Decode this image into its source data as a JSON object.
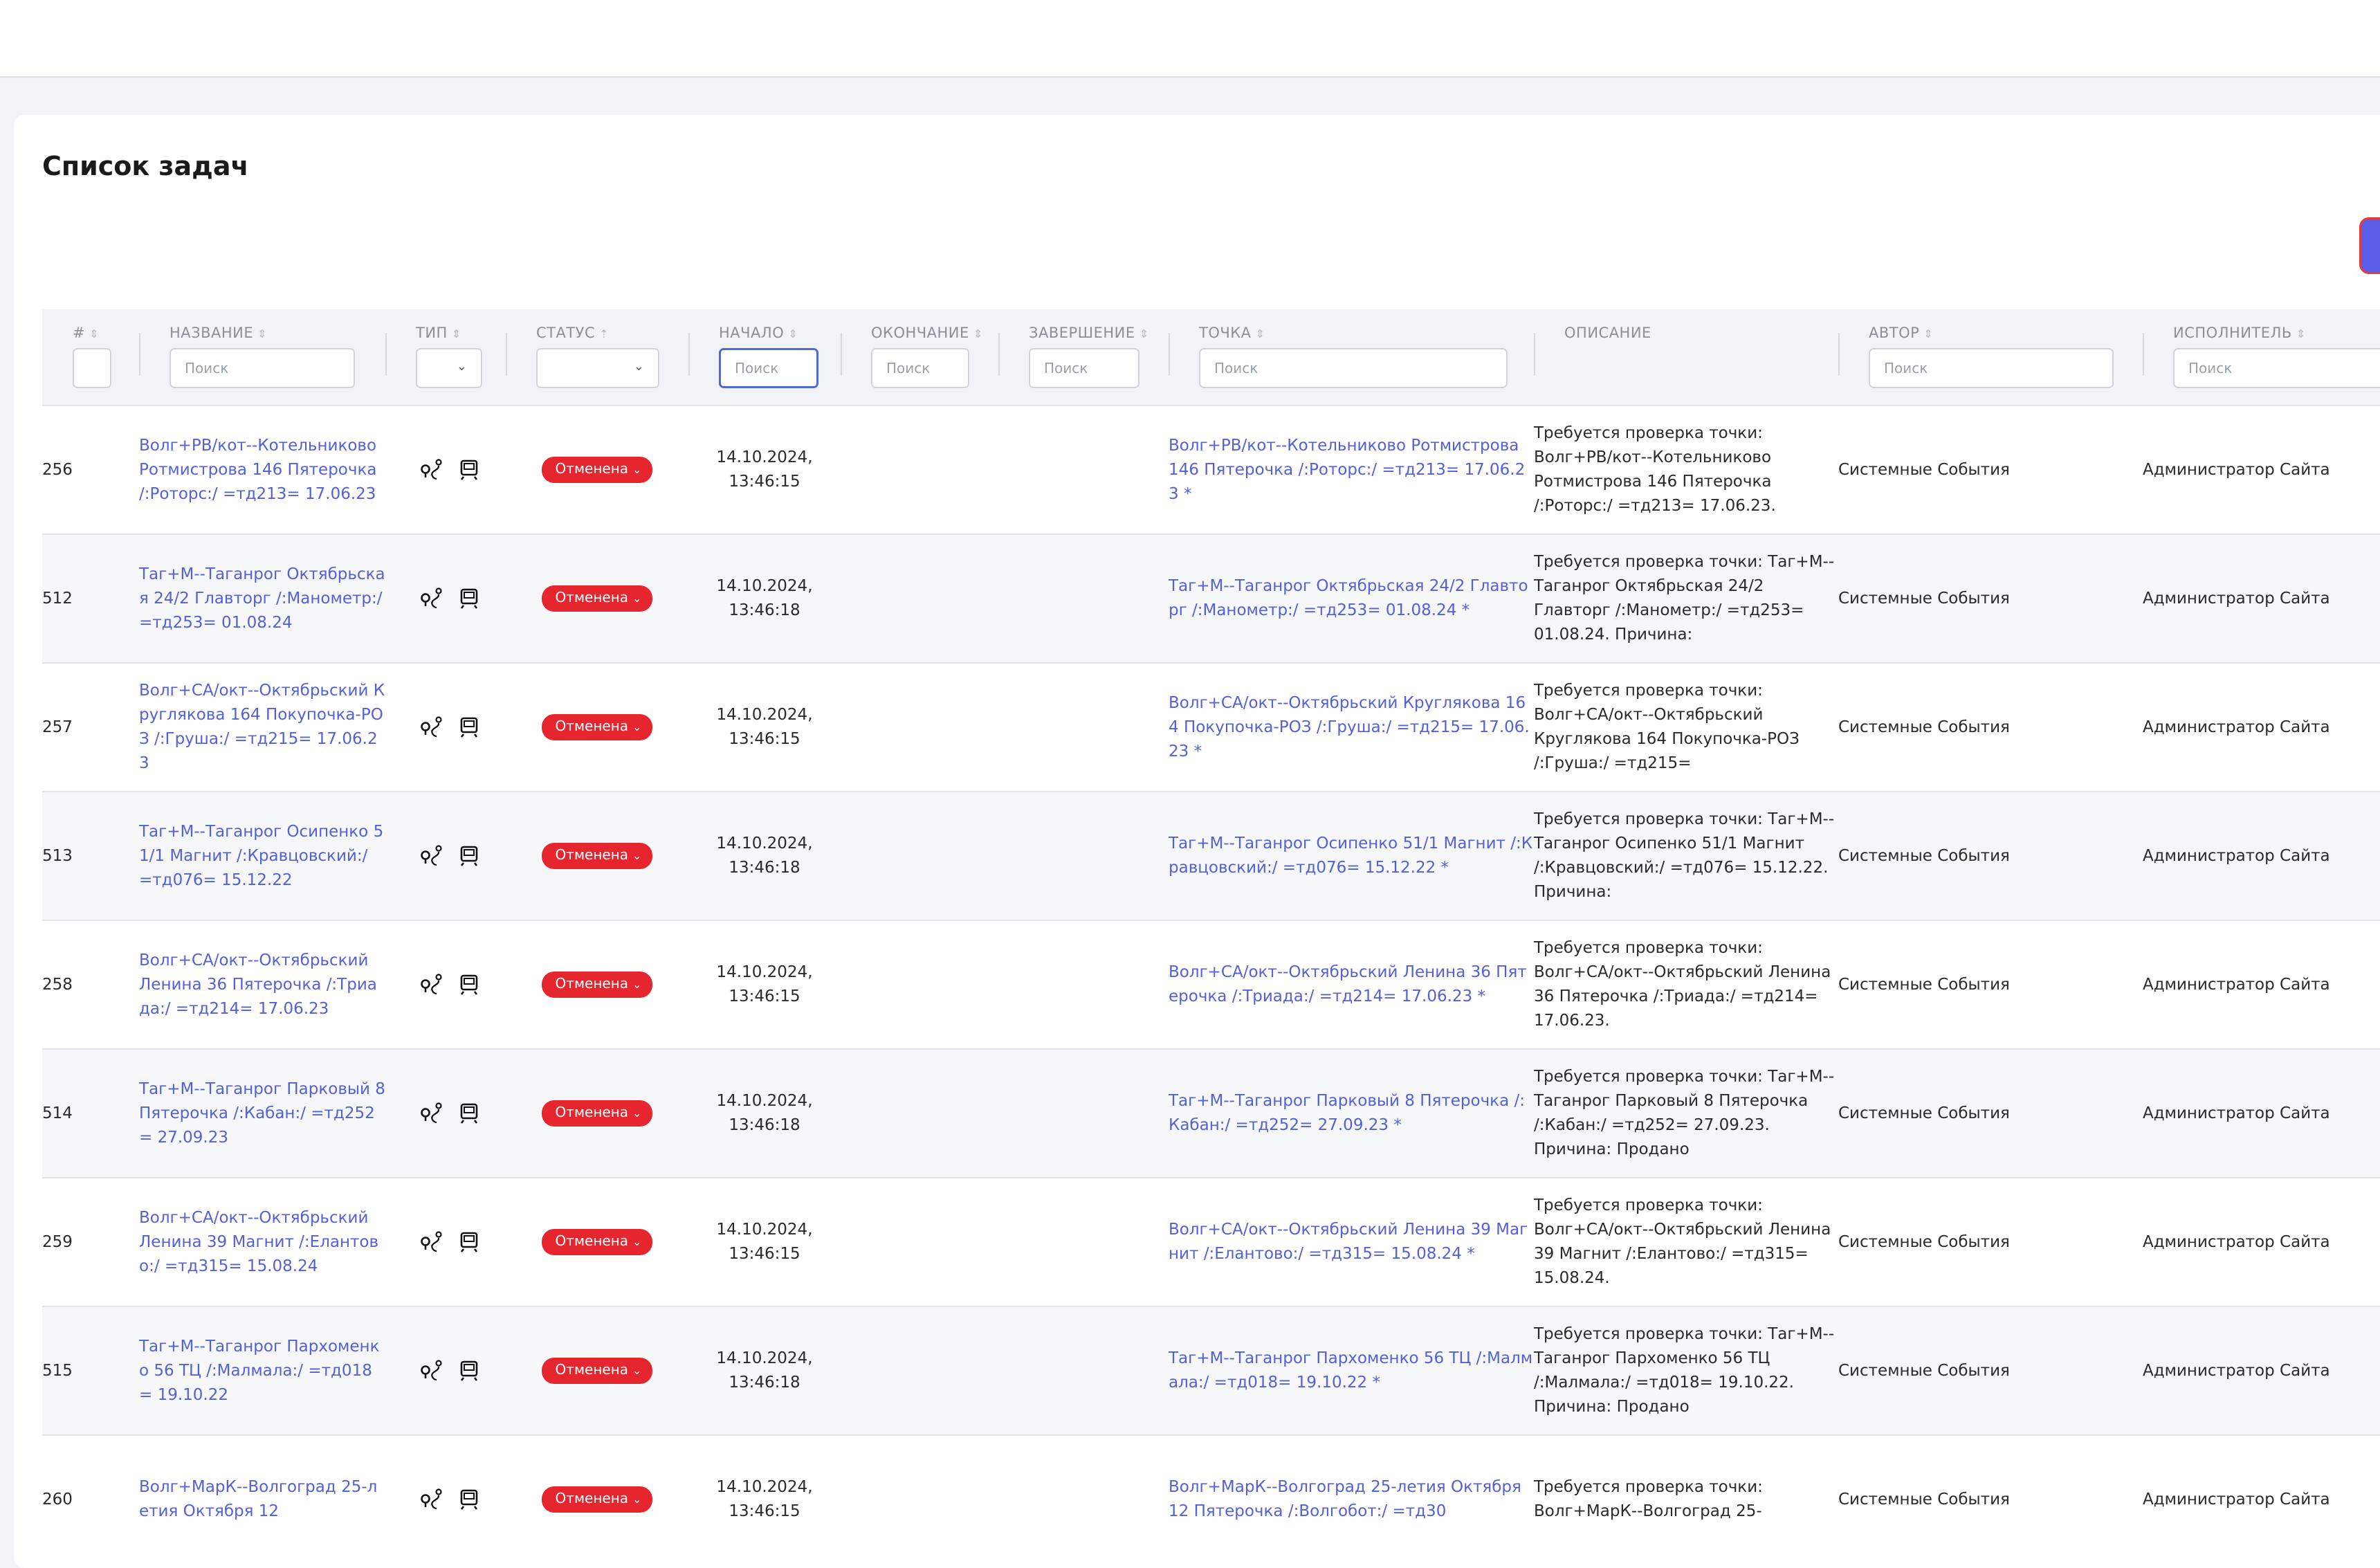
{
  "page": {
    "title": "Список задач"
  },
  "columns": {
    "num": "#",
    "name": "НАЗВАНИЕ",
    "type": "ТИП",
    "status": "СТАТУС",
    "start": "НАЧАЛО",
    "end": "ОКОНЧАНИЕ",
    "completion": "ЗАВЕРШЕНИЕ",
    "point": "ТОЧКА",
    "description": "ОПИСАНИЕ",
    "author": "АВТОР",
    "executor": "ИСПОЛНИТЕЛЬ"
  },
  "filters": {
    "placeholder": "Поиск"
  },
  "rows": [
    {
      "num": "256",
      "name": "Волг+РВ/кот--Котельниково Ротмистрова 146 Пятерочка /:Ротoрс:/ =тд213= 17.06.23",
      "status": "Отменена",
      "start": "14.10.2024, 13:46:15",
      "point": "Волг+РВ/кот--Котельниково Ротмистрова 146 Пятерочка /:Ротoрс:/ =тд213= 17.06.23 *",
      "description": "Требуется проверка точки: Волг+РВ/кот--Котельниково Ротмистрова 146 Пятерочка /:Ротoрс:/ =тд213= 17.06.23.",
      "author": "Системные События",
      "executor": "Администратор Сайта"
    },
    {
      "num": "512",
      "name": "Таг+М--Таганрог Октябрьская 24/2 Главторг /:Манометр:/ =тд253= 01.08.24",
      "status": "Отменена",
      "start": "14.10.2024, 13:46:18",
      "point": "Таг+М--Таганрог Октябрьская 24/2 Главторг /:Манометр:/ =тд253= 01.08.24 *",
      "description": "Требуется проверка точки: Таг+М--Таганрог Октябрьская 24/2 Главторг /:Манометр:/ =тд253= 01.08.24. Причина:",
      "author": "Системные События",
      "executor": "Администратор Сайта"
    },
    {
      "num": "257",
      "name": "Волг+СА/окт--Октябрьский Кругляковa 164 Покупочка-РОЗ /:Груша:/ =тд215= 17.06.23",
      "status": "Отменена",
      "start": "14.10.2024, 13:46:15",
      "point": "Волг+СА/окт--Октябрьский Кругляковa 164 Покупочка-РОЗ /:Груша:/ =тд215= 17.06.23 *",
      "description": "Требуется проверка точки: Волг+СА/окт--Октябрьский Кругляковa 164 Покупочка-РОЗ /:Груша:/ =тд215=",
      "author": "Системные События",
      "executor": "Администратор Сайта"
    },
    {
      "num": "513",
      "name": "Таг+М--Таганрог Осипенко 51/1 Магнит /:Кравцовский:/ =тд076= 15.12.22",
      "status": "Отменена",
      "start": "14.10.2024, 13:46:18",
      "point": "Таг+М--Таганрог Осипенко 51/1 Магнит /:Кравцовский:/ =тд076= 15.12.22 *",
      "description": "Требуется проверка точки: Таг+М--Таганрог Осипенко 51/1 Магнит /:Кравцовский:/ =тд076= 15.12.22. Причина:",
      "author": "Системные События",
      "executor": "Администратор Сайта"
    },
    {
      "num": "258",
      "name": "Волг+СА/окт--Октябрьский Ленина 36 Пятерочка /:Триада:/ =тд214= 17.06.23",
      "status": "Отменена",
      "start": "14.10.2024, 13:46:15",
      "point": "Волг+СА/окт--Октябрьский Ленина 36 Пятерочка /:Триада:/ =тд214= 17.06.23 *",
      "description": "Требуется проверка точки: Волг+СА/окт--Октябрьский Ленина 36 Пятерочка /:Триада:/ =тд214= 17.06.23.",
      "author": "Системные События",
      "executor": "Администратор Сайта"
    },
    {
      "num": "514",
      "name": "Таг+М--Таганрог Парковый 8 Пятерочка /:Кабан:/ =тд252= 27.09.23",
      "status": "Отменена",
      "start": "14.10.2024, 13:46:18",
      "point": "Таг+М--Таганрог Парковый 8 Пятерочка /:Кабан:/ =тд252= 27.09.23 *",
      "description": "Требуется проверка точки: Таг+М--Таганрог Парковый 8 Пятерочка /:Кабан:/ =тд252= 27.09.23. Причина: Продано",
      "author": "Системные События",
      "executor": "Администратор Сайта"
    },
    {
      "num": "259",
      "name": "Волг+СА/окт--Октябрьский Ленина 39 Магнит /:Елантово:/ =тд315= 15.08.24",
      "status": "Отменена",
      "start": "14.10.2024, 13:46:15",
      "point": "Волг+СА/окт--Октябрьский Ленина 39 Магнит /:Елантово:/ =тд315= 15.08.24 *",
      "description": "Требуется проверка точки: Волг+СА/окт--Октябрьский Ленина 39 Магнит /:Елантово:/ =тд315= 15.08.24.",
      "author": "Системные События",
      "executor": "Администратор Сайта"
    },
    {
      "num": "515",
      "name": "Таг+М--Таганрог Пархоменко 56 ТЦ /:Малмала:/ =тд018= 19.10.22",
      "status": "Отменена",
      "start": "14.10.2024, 13:46:18",
      "point": "Таг+М--Таганрог Пархоменко 56 ТЦ /:Малмала:/ =тд018= 19.10.22 *",
      "description": "Требуется проверка точки: Таг+М--Таганрог Пархоменко 56 ТЦ /:Малмала:/ =тд018= 19.10.22. Причина: Продано",
      "author": "Системные События",
      "executor": "Администратор Сайта"
    },
    {
      "num": "260",
      "name": "Волг+МарК--Волгоград 25-летия Октября 12",
      "status": "Отменена",
      "start": "14.10.2024, 13:46:15",
      "point": "Волг+МарК--Волгоград 25-летия Октября 12 Пятерочка /:Волгобот:/ =тд30",
      "description": "Требуется проверка точки: Волг+МарК--Волгоград 25-",
      "author": "Системные События",
      "executor": "Администратор Сайта"
    }
  ],
  "colors": {
    "link": "#5560d6",
    "status_cancelled": "#e5262e",
    "header_bg": "#f1f3f7",
    "accent": "#5a5ee6"
  },
  "icons": {
    "type_route": "route-pin-icon",
    "type_terminal": "terminal-icon",
    "status_chevron": "chevron-down-icon",
    "sort": "sort-icon"
  }
}
